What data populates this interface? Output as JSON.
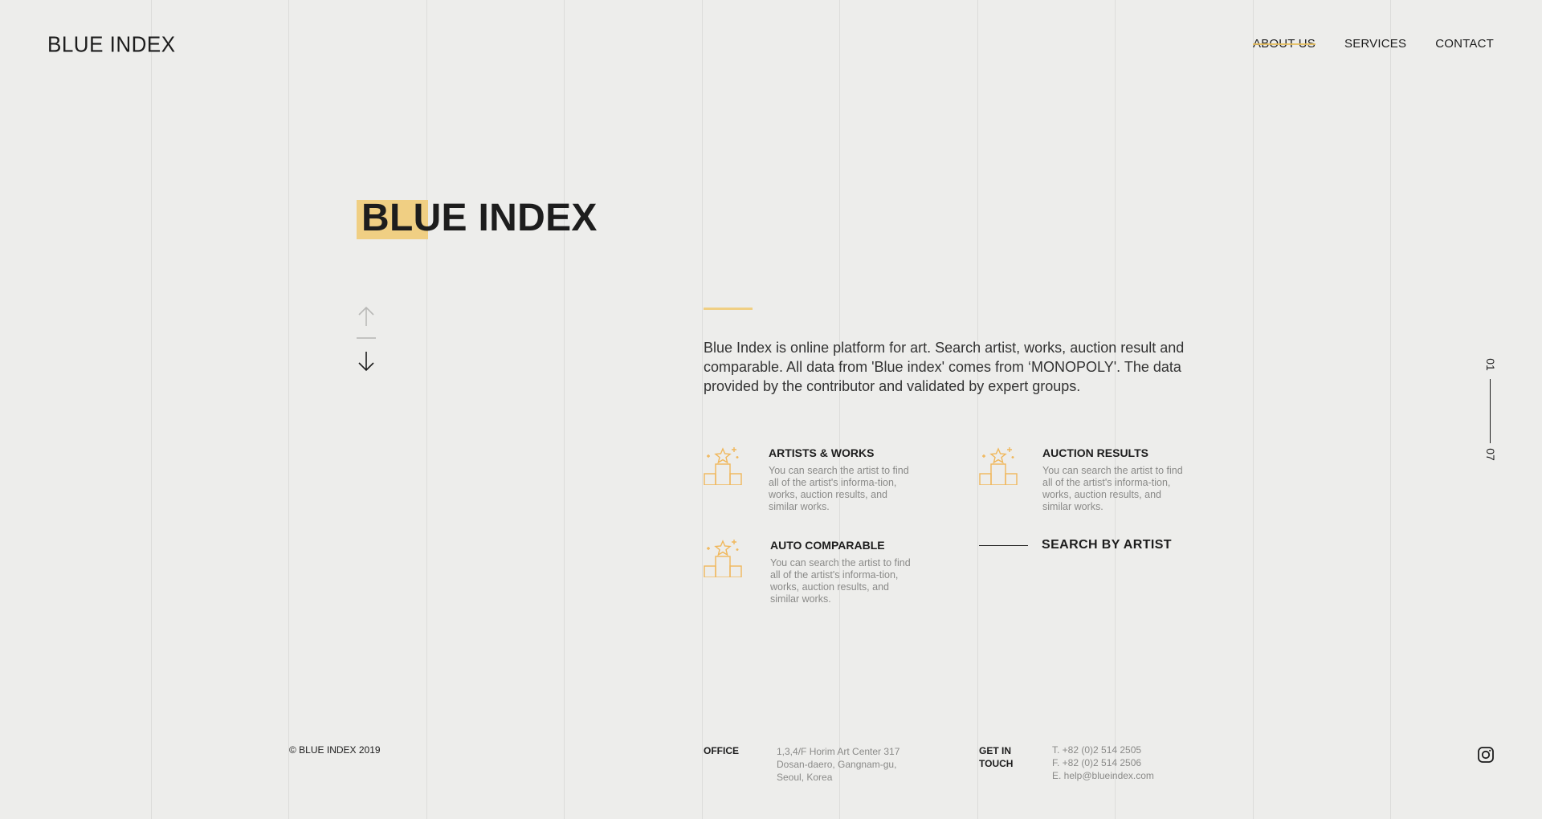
{
  "brand": {
    "logo": "BLUE INDEX"
  },
  "nav": {
    "items": [
      "ABOUT US",
      "SERVICES",
      "CONTACT"
    ],
    "active": "ABOUT US"
  },
  "hero": {
    "title": "BLUE INDEX"
  },
  "intro": {
    "text": "Blue Index is online platform for art. Search artist, works, auction result and comparable. All data from 'Blue index' comes from ‘MONOPOLY'. The data provided by the contributor and validated by expert groups."
  },
  "features": [
    {
      "title": "ARTISTS & WORKS",
      "desc": "You can search the artist to find all of the artist's informa-tion, works, auction results, and similar works.",
      "icon": "podium-star-icon"
    },
    {
      "title": "AUCTION RESULTS",
      "desc": "You can search the artist to find all of the artist's informa-tion, works, auction results, and similar works.",
      "icon": "podium-star-icon"
    },
    {
      "title": "AUTO COMPARABLE",
      "desc": "You can search the artist to find all of the artist's informa-tion, works, auction results, and similar works.",
      "icon": "podium-star-icon"
    }
  ],
  "search_by_artist": {
    "label": "SEARCH BY ARTIST"
  },
  "pager": {
    "current": "01",
    "total": "07"
  },
  "footer": {
    "copyright": "© BLUE INDEX 2019",
    "office_label": "OFFICE",
    "office_lines": [
      "1,3,4/F Horim Art Center 317",
      "Dosan-daero, Gangnam-gu,",
      "Seoul, Korea"
    ],
    "contact_label_lines": [
      "GET IN",
      "TOUCH"
    ],
    "contact_lines": [
      "T. +82 (0)2 514 2505",
      "F. +82 (0)2 514 2506",
      "E. help@blueindex.com"
    ],
    "social_icon": "instagram-icon"
  },
  "colors": {
    "background": "#ededeb",
    "accent": "#f0cf83",
    "icon_accent": "#f0b75a",
    "text": "#1d1d1d",
    "muted": "#8a8a88"
  }
}
